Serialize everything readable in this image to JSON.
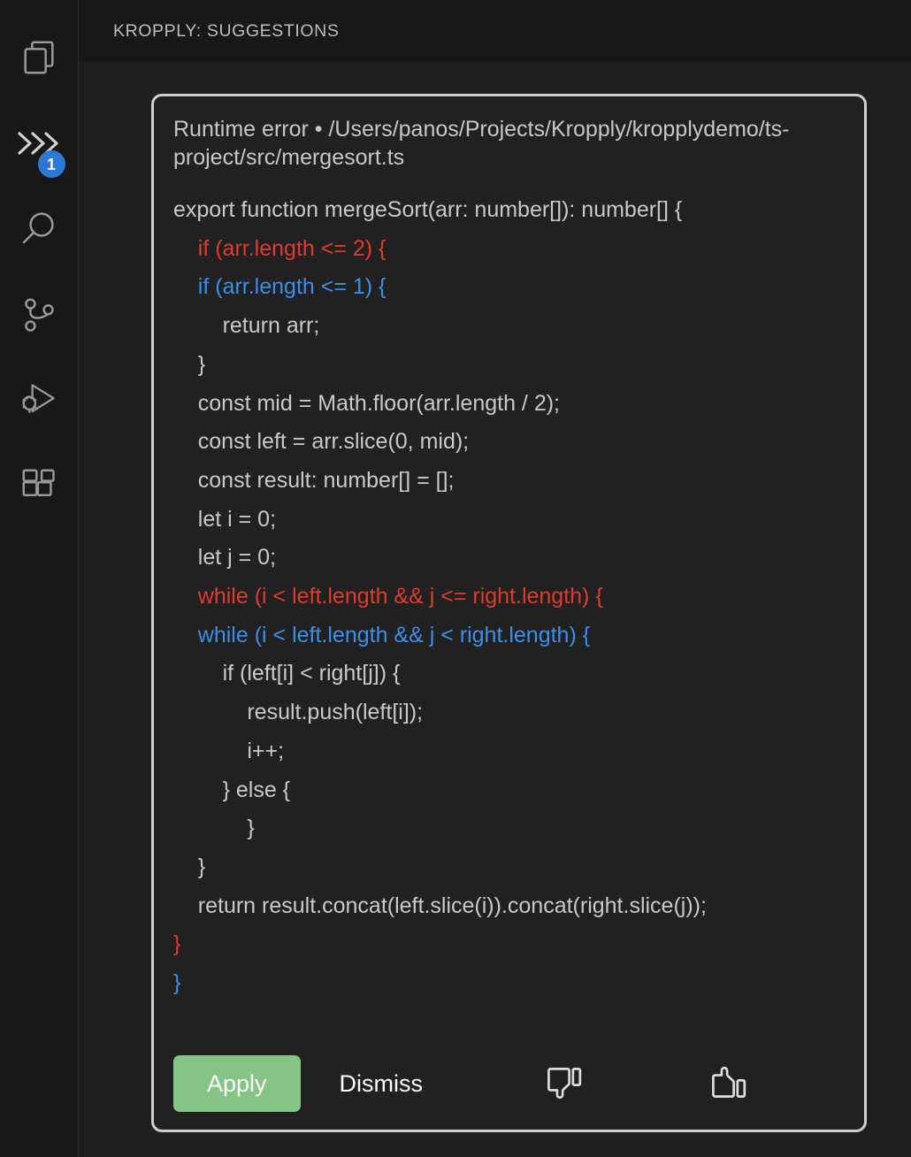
{
  "activity_bar": {
    "items": [
      {
        "name": "explorer",
        "icon": "files-icon",
        "badge": null
      },
      {
        "name": "kropply-suggestions",
        "icon": "chevrons-right-icon",
        "badge": "1"
      },
      {
        "name": "search",
        "icon": "search-icon",
        "badge": null
      },
      {
        "name": "source-control",
        "icon": "source-control-icon",
        "badge": null
      },
      {
        "name": "run-and-debug",
        "icon": "run-debug-icon",
        "badge": null
      },
      {
        "name": "extensions",
        "icon": "extensions-icon",
        "badge": null
      }
    ]
  },
  "header": {
    "title": "KROPPLY: SUGGESTIONS"
  },
  "card": {
    "title": "Runtime error • /Users/panos/Projects/Kropply/kropplydemo/ts-project/src/mergesort.ts",
    "code_lines": [
      {
        "type": "context",
        "text": "export function mergeSort(arr: number[]): number[] {"
      },
      {
        "type": "removed",
        "text": "    if (arr.length <= 2) {"
      },
      {
        "type": "added",
        "text": "    if (arr.length <= 1) {"
      },
      {
        "type": "context",
        "text": "        return arr;"
      },
      {
        "type": "context",
        "text": "    }"
      },
      {
        "type": "context",
        "text": "    const mid = Math.floor(arr.length / 2);"
      },
      {
        "type": "context",
        "text": "    const left = arr.slice(0, mid);"
      },
      {
        "type": "context",
        "text": "    const result: number[] = [];"
      },
      {
        "type": "context",
        "text": "    let i = 0;"
      },
      {
        "type": "context",
        "text": "    let j = 0;"
      },
      {
        "type": "removed",
        "text": "    while (i < left.length && j <= right.length) {"
      },
      {
        "type": "added",
        "text": "    while (i < left.length && j < right.length) {"
      },
      {
        "type": "context",
        "text": "        if (left[i] < right[j]) {"
      },
      {
        "type": "context",
        "text": "            result.push(left[i]);"
      },
      {
        "type": "context",
        "text": "            i++;"
      },
      {
        "type": "context",
        "text": "        } else {"
      },
      {
        "type": "context",
        "text": "            }"
      },
      {
        "type": "context",
        "text": "    }"
      },
      {
        "type": "context",
        "text": "    return result.concat(left.slice(i)).concat(right.slice(j));"
      },
      {
        "type": "removed",
        "text": "}"
      },
      {
        "type": "added",
        "text": "}"
      }
    ],
    "actions": {
      "apply_label": "Apply",
      "dismiss_label": "Dismiss",
      "thumbs_down_icon": "thumbs-down-icon",
      "thumbs_up_icon": "thumbs-up-icon"
    }
  },
  "colors": {
    "accent_green": "#84c586",
    "badge_blue": "#2b79d4",
    "diff_removed": "#e13b2d",
    "diff_added": "#3c8fe8",
    "panel_bg": "#1f1f1f",
    "activity_bg": "#181818",
    "card_border": "#cfcfcf"
  }
}
